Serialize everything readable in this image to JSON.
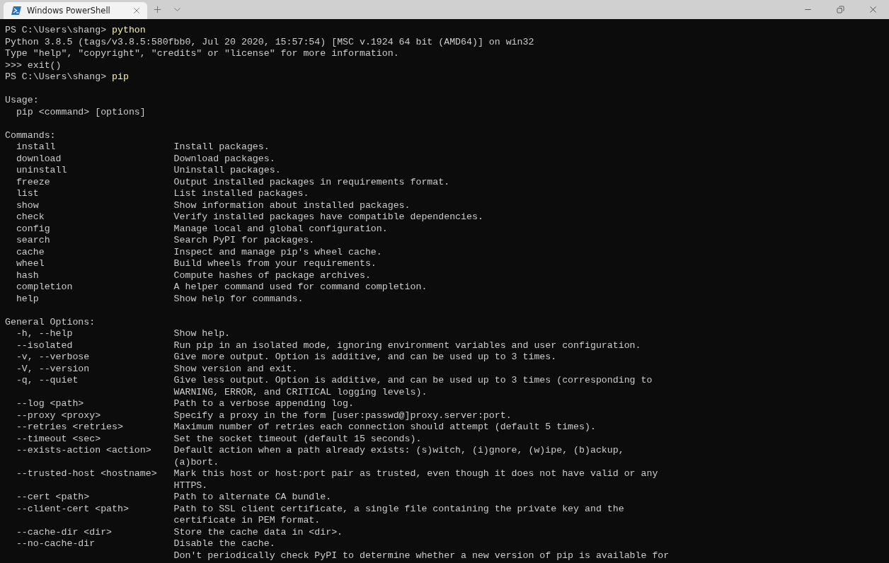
{
  "window": {
    "tab": {
      "title": "Windows PowerShell",
      "selected": true
    }
  },
  "lines": [
    {
      "kind": "prompt",
      "prompt": "PS C:\\Users\\shang>",
      "command": "python"
    },
    {
      "kind": "text",
      "text": "Python 3.8.5 (tags/v3.8.5:580fbb0, Jul 20 2020, 15:57:54) [MSC v.1924 64 bit (AMD64)] on win32"
    },
    {
      "kind": "text",
      "text": "Type \"help\", \"copyright\", \"credits\" or \"license\" for more information."
    },
    {
      "kind": "text",
      "text": ">>> exit()"
    },
    {
      "kind": "prompt",
      "prompt": "PS C:\\Users\\shang>",
      "command": "pip"
    },
    {
      "kind": "blank"
    },
    {
      "kind": "text",
      "text": "Usage:"
    },
    {
      "kind": "indented",
      "text": "pip <command> [options]"
    },
    {
      "kind": "blank"
    },
    {
      "kind": "text",
      "text": "Commands:"
    },
    {
      "kind": "entry",
      "term": "install",
      "description": "Install packages."
    },
    {
      "kind": "entry",
      "term": "download",
      "description": "Download packages."
    },
    {
      "kind": "entry",
      "term": "uninstall",
      "description": "Uninstall packages."
    },
    {
      "kind": "entry",
      "term": "freeze",
      "description": "Output installed packages in requirements format."
    },
    {
      "kind": "entry",
      "term": "list",
      "description": "List installed packages."
    },
    {
      "kind": "entry",
      "term": "show",
      "description": "Show information about installed packages."
    },
    {
      "kind": "entry",
      "term": "check",
      "description": "Verify installed packages have compatible dependencies."
    },
    {
      "kind": "entry",
      "term": "config",
      "description": "Manage local and global configuration."
    },
    {
      "kind": "entry",
      "term": "search",
      "description": "Search PyPI for packages."
    },
    {
      "kind": "entry",
      "term": "cache",
      "description": "Inspect and manage pip's wheel cache."
    },
    {
      "kind": "entry",
      "term": "wheel",
      "description": "Build wheels from your requirements."
    },
    {
      "kind": "entry",
      "term": "hash",
      "description": "Compute hashes of package archives."
    },
    {
      "kind": "entry",
      "term": "completion",
      "description": "A helper command used for command completion."
    },
    {
      "kind": "entry",
      "term": "help",
      "description": "Show help for commands."
    },
    {
      "kind": "blank"
    },
    {
      "kind": "text",
      "text": "General Options:"
    },
    {
      "kind": "entry",
      "term": "-h, --help",
      "description": "Show help."
    },
    {
      "kind": "entry",
      "term": "--isolated",
      "description": "Run pip in an isolated mode, ignoring environment variables and user configuration."
    },
    {
      "kind": "entry",
      "term": "-v, --verbose",
      "description": "Give more output. Option is additive, and can be used up to 3 times."
    },
    {
      "kind": "entry",
      "term": "-V, --version",
      "description": "Show version and exit."
    },
    {
      "kind": "entry",
      "term": "-q, --quiet",
      "description": "Give less output. Option is additive, and can be used up to 3 times (corresponding to"
    },
    {
      "kind": "continuation",
      "description": "WARNING, ERROR, and CRITICAL logging levels)."
    },
    {
      "kind": "entry",
      "term": "--log <path>",
      "description": "Path to a verbose appending log."
    },
    {
      "kind": "entry",
      "term": "--proxy <proxy>",
      "description": "Specify a proxy in the form [user:passwd@]proxy.server:port."
    },
    {
      "kind": "entry",
      "term": "--retries <retries>",
      "description": "Maximum number of retries each connection should attempt (default 5 times)."
    },
    {
      "kind": "entry",
      "term": "--timeout <sec>",
      "description": "Set the socket timeout (default 15 seconds)."
    },
    {
      "kind": "entry",
      "term": "--exists-action <action>",
      "description": "Default action when a path already exists: (s)witch, (i)gnore, (w)ipe, (b)ackup,"
    },
    {
      "kind": "continuation",
      "description": "(a)bort."
    },
    {
      "kind": "entry",
      "term": "--trusted-host <hostname>",
      "description": "Mark this host or host:port pair as trusted, even though it does not have valid or any"
    },
    {
      "kind": "continuation",
      "description": "HTTPS."
    },
    {
      "kind": "entry",
      "term": "--cert <path>",
      "description": "Path to alternate CA bundle."
    },
    {
      "kind": "entry",
      "term": "--client-cert <path>",
      "description": "Path to SSL client certificate, a single file containing the private key and the"
    },
    {
      "kind": "continuation",
      "description": "certificate in PEM format."
    },
    {
      "kind": "entry",
      "term": "--cache-dir <dir>",
      "description": "Store the cache data in <dir>."
    },
    {
      "kind": "entry",
      "term": "--no-cache-dir",
      "description": "Disable the cache."
    },
    {
      "kind": "continuation",
      "description": "Don't periodically check PyPI to determine whether a new version of pip is available for"
    }
  ]
}
